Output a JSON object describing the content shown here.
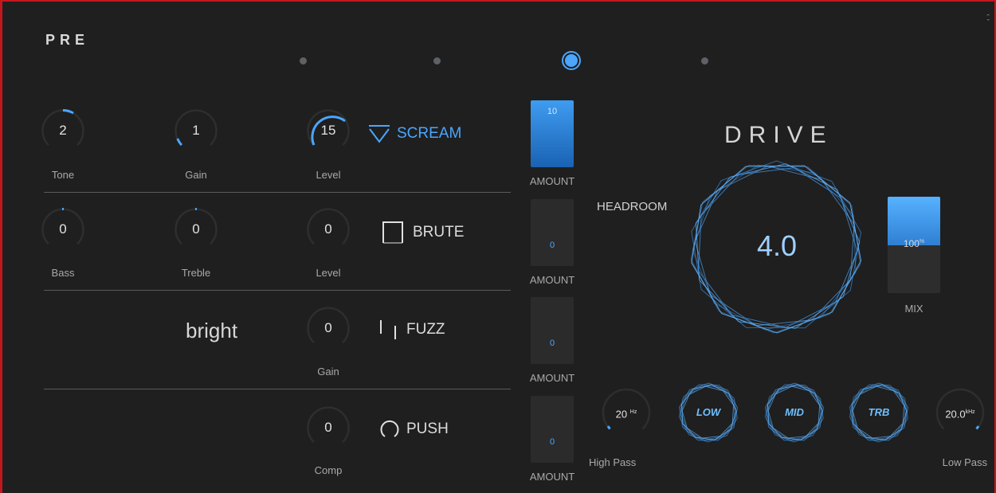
{
  "header": {
    "title": "PRE",
    "close_icon": "collapse-icon",
    "pages": [
      {
        "active": false
      },
      {
        "active": false
      },
      {
        "active": true
      },
      {
        "active": false
      }
    ]
  },
  "colors": {
    "accent": "#4aa6ff",
    "background": "#1f1f1f",
    "frame": "#c2171d"
  },
  "rows": [
    {
      "knobs": [
        {
          "value": "2",
          "label": "Tone"
        },
        {
          "value": "1",
          "label": "Gain"
        },
        {
          "value": "15",
          "label": "Level"
        }
      ],
      "mode": {
        "label": "SCREAM",
        "icon": "triangle-down-icon",
        "active": true
      },
      "amount": {
        "value": "10",
        "label": "AMOUNT",
        "filled": true
      }
    },
    {
      "knobs": [
        {
          "value": "0",
          "label": "Bass"
        },
        {
          "value": "0",
          "label": "Treble"
        },
        {
          "value": "0",
          "label": "Level"
        }
      ],
      "mode": {
        "label": "BRUTE",
        "icon": "square-icon",
        "active": false
      },
      "amount": {
        "value": "0",
        "label": "AMOUNT",
        "filled": false
      }
    },
    {
      "bright_label": "bright",
      "knobs": [
        {
          "value": "0",
          "label": "Gain"
        }
      ],
      "mode": {
        "label": "FUZZ",
        "icon": "bars-icon",
        "active": false
      },
      "amount": {
        "value": "0",
        "label": "AMOUNT",
        "filled": false
      }
    },
    {
      "knobs": [
        {
          "value": "0",
          "label": "Comp"
        }
      ],
      "mode": {
        "label": "PUSH",
        "icon": "ring-icon",
        "active": false
      },
      "amount": {
        "value": "0",
        "label": "AMOUNT",
        "filled": false
      }
    }
  ],
  "drive": {
    "title": "DRIVE",
    "value": "4.0",
    "headroom_label": "HEADROOM",
    "mix": {
      "value": "100",
      "unit": "%",
      "label": "MIX",
      "level": 0.5
    },
    "high_pass": {
      "value": "20",
      "unit": "Hz",
      "label": "High Pass"
    },
    "low_pass": {
      "value": "20.0",
      "unit": "kHz",
      "label": "Low Pass"
    },
    "bands": [
      {
        "label": "LOW"
      },
      {
        "label": "MID"
      },
      {
        "label": "TRB"
      }
    ]
  }
}
